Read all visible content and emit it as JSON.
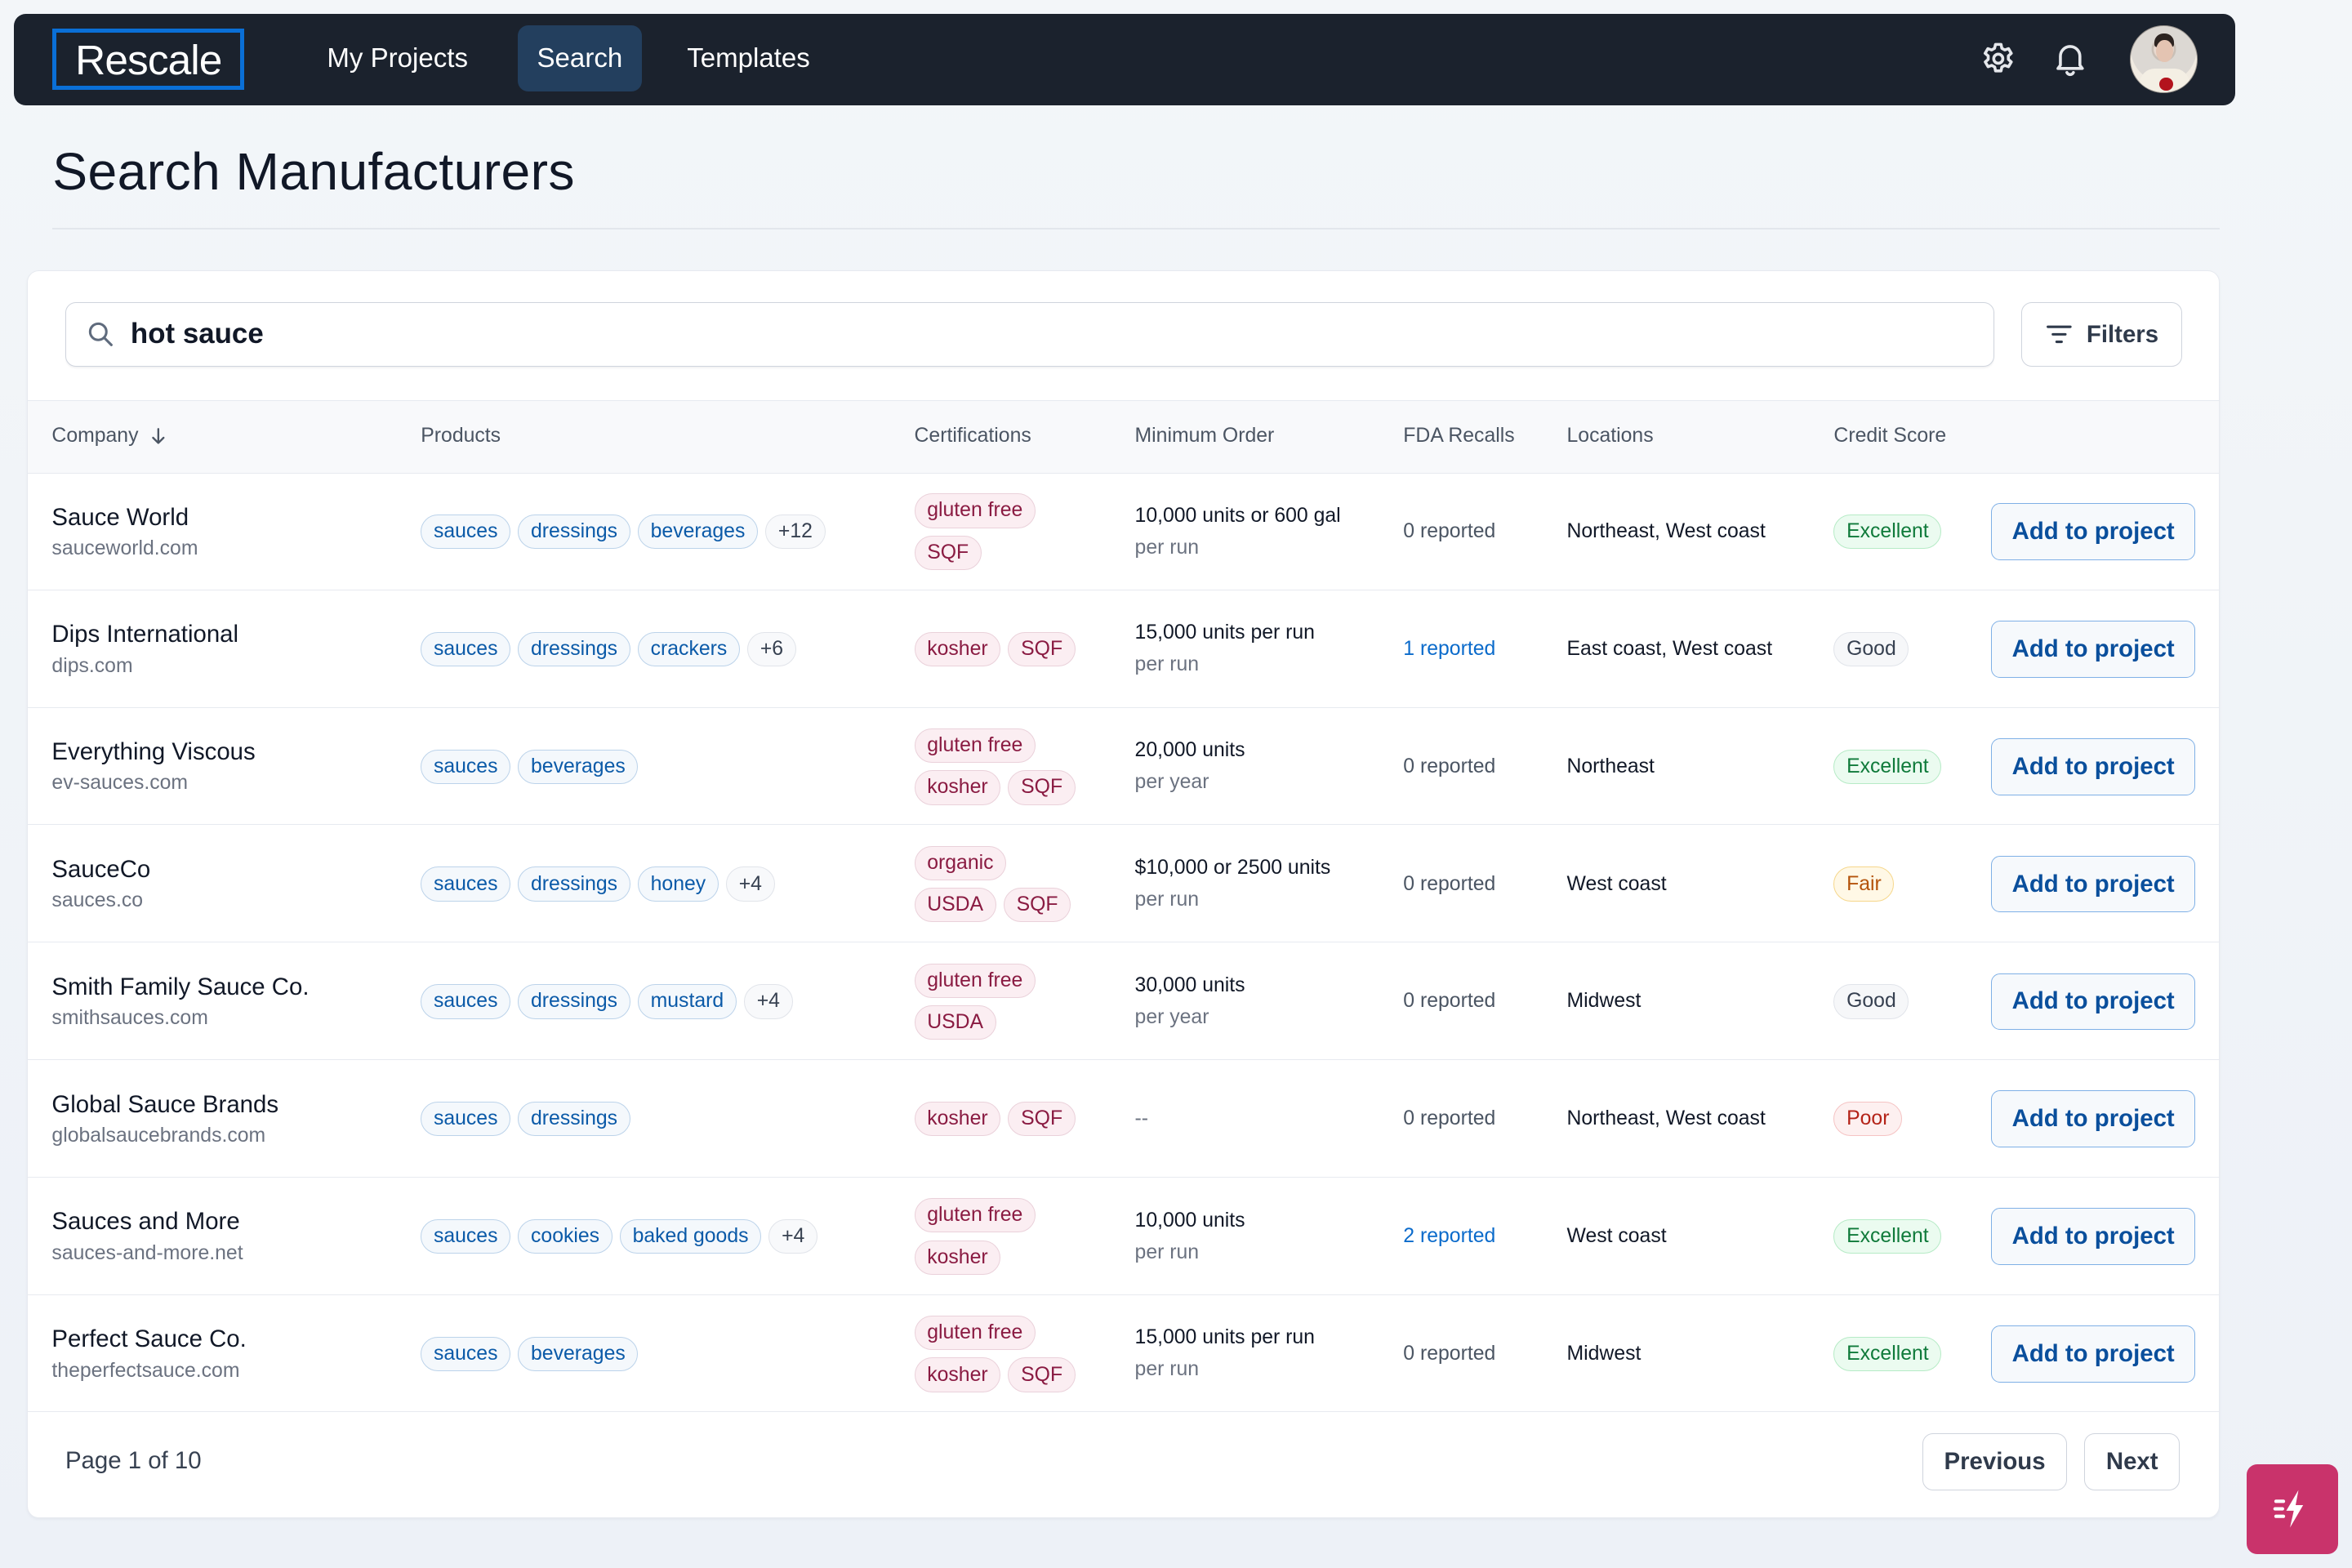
{
  "nav": {
    "logo": "Rescale",
    "tabs": [
      {
        "label": "My Projects",
        "active": false
      },
      {
        "label": "Search",
        "active": true
      },
      {
        "label": "Templates",
        "active": false
      }
    ],
    "icons": [
      "gear-icon",
      "bell-icon"
    ],
    "avatar_alt": "User avatar"
  },
  "page": {
    "title": "Search Manufacturers"
  },
  "search": {
    "value": "hot sauce",
    "icon": "search-icon",
    "filters_label": "Filters"
  },
  "table": {
    "columns": [
      "Company",
      "Products",
      "Certifications",
      "Minimum Order",
      "FDA Recalls",
      "Locations",
      "Credit Score"
    ],
    "sort_column": "Company",
    "sort_direction": "descending",
    "action_label": "Add to project",
    "rows": [
      {
        "company": "Sauce World",
        "url": "sauceworld.com",
        "products": [
          "sauces",
          "dressings",
          "beverages"
        ],
        "more_products": "+12",
        "certifications": [
          [
            "gluten free"
          ],
          [
            "SQF"
          ]
        ],
        "min_order": "10,000 units or 600 gal",
        "min_order_unit": "per run",
        "fda_recalls": "0 reported",
        "recall_link": false,
        "locations": "Northeast, West coast",
        "credit_score": "Excellent",
        "credit_level": "excellent"
      },
      {
        "company": "Dips International",
        "url": "dips.com",
        "products": [
          "sauces",
          "dressings",
          "crackers"
        ],
        "more_products": "+6",
        "certifications": [
          [
            "kosher",
            "SQF"
          ]
        ],
        "min_order": "15,000 units per run",
        "min_order_unit": "per run",
        "fda_recalls": "1 reported",
        "recall_link": true,
        "locations": "East coast, West coast",
        "credit_score": "Good",
        "credit_level": "good"
      },
      {
        "company": "Everything Viscous",
        "url": "ev-sauces.com",
        "products": [
          "sauces",
          "beverages"
        ],
        "more_products": "",
        "certifications": [
          [
            "gluten free"
          ],
          [
            "kosher",
            "SQF"
          ]
        ],
        "min_order": "20,000 units",
        "min_order_unit": "per year",
        "fda_recalls": "0 reported",
        "recall_link": false,
        "locations": "Northeast",
        "credit_score": "Excellent",
        "credit_level": "excellent"
      },
      {
        "company": "SauceCo",
        "url": "sauces.co",
        "products": [
          "sauces",
          "dressings",
          "honey"
        ],
        "more_products": "+4",
        "certifications": [
          [
            "organic"
          ],
          [
            "USDA",
            "SQF"
          ]
        ],
        "min_order": "$10,000 or 2500 units",
        "min_order_unit": "per run",
        "fda_recalls": "0 reported",
        "recall_link": false,
        "locations": "West coast",
        "credit_score": "Fair",
        "credit_level": "fair"
      },
      {
        "company": "Smith Family Sauce Co.",
        "url": "smithsauces.com",
        "products": [
          "sauces",
          "dressings",
          "mustard"
        ],
        "more_products": "+4",
        "certifications": [
          [
            "gluten free"
          ],
          [
            "USDA"
          ]
        ],
        "min_order": "30,000 units",
        "min_order_unit": "per year",
        "fda_recalls": "0 reported",
        "recall_link": false,
        "locations": "Midwest",
        "credit_score": "Good",
        "credit_level": "good"
      },
      {
        "company": "Global Sauce Brands",
        "url": "globalsaucebrands.com",
        "products": [
          "sauces",
          "dressings"
        ],
        "more_products": "",
        "certifications": [
          [
            "kosher",
            "SQF"
          ]
        ],
        "min_order": "--",
        "min_order_unit": "",
        "fda_recalls": "0 reported",
        "recall_link": false,
        "locations": "Northeast, West coast",
        "credit_score": "Poor",
        "credit_level": "poor"
      },
      {
        "company": "Sauces and More",
        "url": "sauces-and-more.net",
        "products": [
          "sauces",
          "cookies",
          "baked goods"
        ],
        "more_products": "+4",
        "certifications": [
          [
            "gluten free"
          ],
          [
            "kosher"
          ]
        ],
        "min_order": "10,000 units",
        "min_order_unit": "per run",
        "fda_recalls": "2 reported",
        "recall_link": true,
        "locations": "West coast",
        "credit_score": "Excellent",
        "credit_level": "excellent"
      },
      {
        "company": "Perfect Sauce Co.",
        "url": "theperfectsauce.com",
        "products": [
          "sauces",
          "beverages"
        ],
        "more_products": "",
        "certifications": [
          [
            "gluten free"
          ],
          [
            "kosher",
            "SQF"
          ]
        ],
        "min_order": "15,000 units per run",
        "min_order_unit": "per run",
        "fda_recalls": "0 reported",
        "recall_link": false,
        "locations": "Midwest",
        "credit_score": "Excellent",
        "credit_level": "excellent"
      }
    ]
  },
  "pagination": {
    "label": "Page 1 of 10",
    "current_page": 1,
    "total_pages": 10,
    "previous_label": "Previous",
    "next_label": "Next"
  },
  "fab": {
    "icon": "lightning-icon"
  },
  "colors": {
    "nav_bg": "#1b222d",
    "nav_active": "#233f5e",
    "logo_border": "#0a6fd6",
    "accent_blue": "#0a4f9c",
    "fab_pink": "#c9336b"
  }
}
